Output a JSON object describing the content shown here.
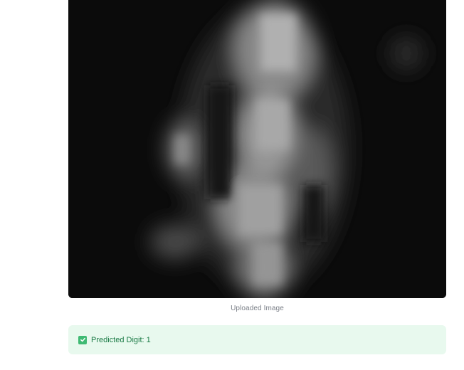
{
  "uploaded_image": {
    "caption": "Uploaded Image"
  },
  "result": {
    "text": "Predicted Digit: 1",
    "icon": "check-icon",
    "status_color": "#3fba73",
    "background_color": "#e8f9ee"
  }
}
